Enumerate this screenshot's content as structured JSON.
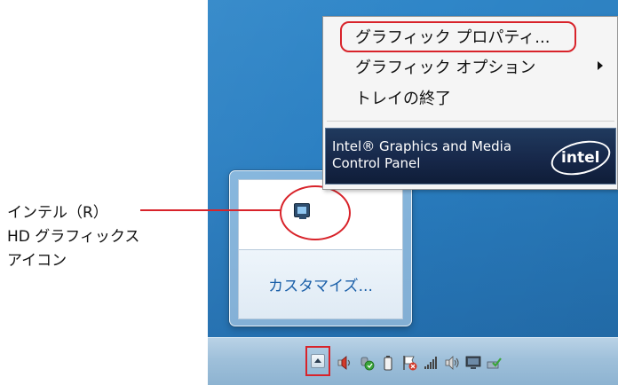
{
  "context_menu": {
    "items": [
      {
        "label": "グラフィック プロパティ..."
      },
      {
        "label": "グラフィック オプション"
      },
      {
        "label": "トレイの終了"
      }
    ],
    "banner_text": "Intel® Graphics and Media\nControl Panel",
    "banner_logo": "intel"
  },
  "overflow_popup": {
    "customize_label": "カスタマイズ..."
  },
  "annotation": {
    "lines": [
      "インテル（R）",
      "HD グラフィックス",
      "アイコン"
    ]
  },
  "colors": {
    "highlight": "#d8232a",
    "desktop": "#2a7fc2",
    "banner": "#17284a",
    "link": "#1a5fa8"
  }
}
